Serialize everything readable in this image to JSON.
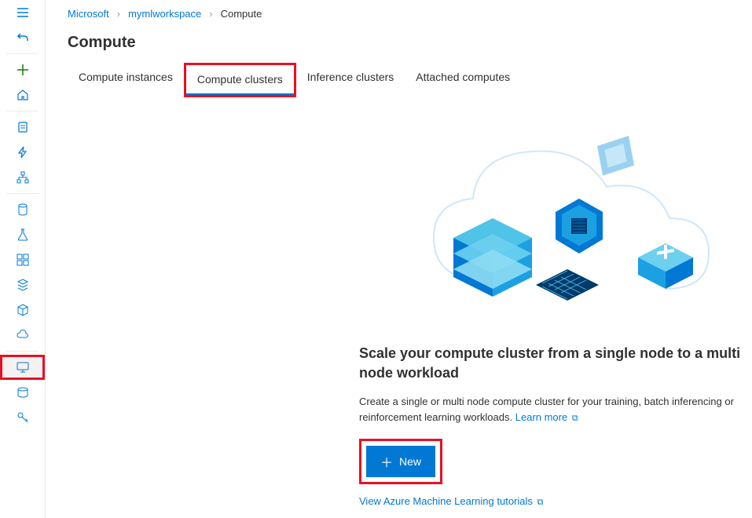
{
  "breadcrumb": {
    "items": [
      "Microsoft",
      "mymlworkspace",
      "Compute"
    ]
  },
  "page_title": "Compute",
  "tabs": {
    "items": [
      {
        "label": "Compute instances",
        "active": false,
        "highlighted": false
      },
      {
        "label": "Compute clusters",
        "active": true,
        "highlighted": true
      },
      {
        "label": "Inference clusters",
        "active": false,
        "highlighted": false
      },
      {
        "label": "Attached computes",
        "active": false,
        "highlighted": false
      }
    ]
  },
  "hero": {
    "heading": "Scale your compute cluster from a single node to a multi node workload",
    "description": "Create a single or multi node compute cluster for your training, batch inferencing or reinforcement learning workloads. ",
    "learn_more": "Learn more",
    "new_button": "New",
    "tutorials_link": "View Azure Machine Learning tutorials"
  },
  "sidebar": {
    "icons": [
      "menu",
      "undo",
      "divider",
      "plus",
      "home",
      "divider",
      "clipboard",
      "lightning",
      "network",
      "divider",
      "database",
      "flask",
      "grid",
      "stack",
      "cube",
      "cloud",
      "divider",
      "monitor",
      "disk",
      "key"
    ],
    "highlighted_index": 17
  },
  "colors": {
    "primary": "#0078d4",
    "highlight_border": "#e81123"
  }
}
